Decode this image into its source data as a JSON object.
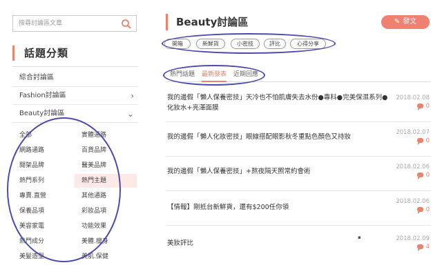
{
  "search": {
    "placeholder": "搜尋討論區文章"
  },
  "sidebar": {
    "section_title": "話題分類",
    "categories": [
      {
        "label": "綜合討論區",
        "chevron": ""
      },
      {
        "label": "Fashion討論區",
        "chevron": "›"
      },
      {
        "label": "Beauty討論區",
        "chevron": "⌄"
      }
    ],
    "sub_items": [
      [
        "全部",
        "實體通路"
      ],
      [
        "網路通路",
        "百貨品牌"
      ],
      [
        "開架品牌",
        "醫美品牌"
      ],
      [
        "熱門系列",
        "熱門主題"
      ],
      [
        "專賣.直營",
        "其他通路"
      ],
      [
        "保養品項",
        "彩妝品項"
      ],
      [
        "美容家電",
        "功能效果"
      ],
      [
        "熱門成分",
        "美體.瘦身"
      ],
      [
        "美髮造型",
        "美肌.保健"
      ]
    ],
    "active_sub": "熱門主題"
  },
  "main": {
    "title": "Beauty討論區",
    "post_button": "發文",
    "tags": [
      "開箱",
      "新鮮貨",
      "小密技",
      "評比",
      "心得分享"
    ],
    "tabs": [
      "熱門話題",
      "最新發表",
      "近期回應"
    ],
    "active_tab": "最新發表",
    "posts": [
      {
        "title": "我的邊假「懶人保養密技」天冷也不怕肌膚失去水份●專科●完美保濕系列●化妝水+亮澤面膜",
        "date": "2018.02.08",
        "count": "0"
      },
      {
        "title": "我的邊假「懶人化妝密技」眼線搭配眼影秋冬重點色顏色又持妝",
        "date": "2018.02.07",
        "count": "0"
      },
      {
        "title": "我的邊假「懶人保養密技」+熬夜隔天照常約會術",
        "date": "2018.02.06",
        "count": "0"
      },
      {
        "title": "【情報】剛抵台新鮮貨，還有$200任你領",
        "date": "2018.02.06",
        "count": "0"
      },
      {
        "title": "美妝評比",
        "date": "2018.02.09",
        "count": "4"
      }
    ]
  },
  "icons": {
    "search": "search-icon",
    "post": "pencil-icon",
    "comment": "comment-icon",
    "chevron": "chevron-icon"
  },
  "colors": {
    "accent": "#e8836f",
    "annotation": "#4a4ab0"
  }
}
